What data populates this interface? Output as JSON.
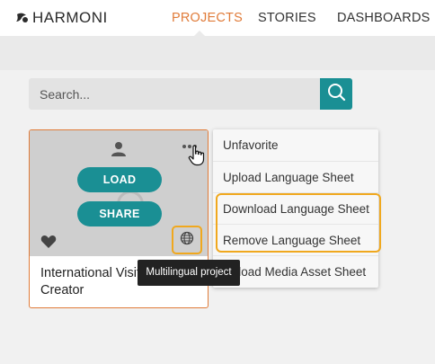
{
  "app": {
    "logo_text": "HARMONI"
  },
  "nav": {
    "projects": "PROJECTS",
    "stories": "STORIES",
    "dashboards": "DASHBOARDS",
    "active": "PROJECTS"
  },
  "search": {
    "placeholder": "Search...",
    "value": ""
  },
  "card": {
    "load_label": "LOAD",
    "share_label": "SHARE",
    "title": "International Visitor Creator"
  },
  "tooltip": {
    "text": "Multilingual project"
  },
  "menu": {
    "items": [
      {
        "label": "Unfavorite"
      },
      {
        "label": "Upload Language Sheet"
      },
      {
        "label": "Download Language Sheet"
      },
      {
        "label": "Remove Language Sheet"
      },
      {
        "label": "Upload Media Asset Sheet"
      }
    ]
  },
  "colors": {
    "accent_orange": "#e07b39",
    "teal": "#1a8f94",
    "highlight": "#f0a81e"
  }
}
